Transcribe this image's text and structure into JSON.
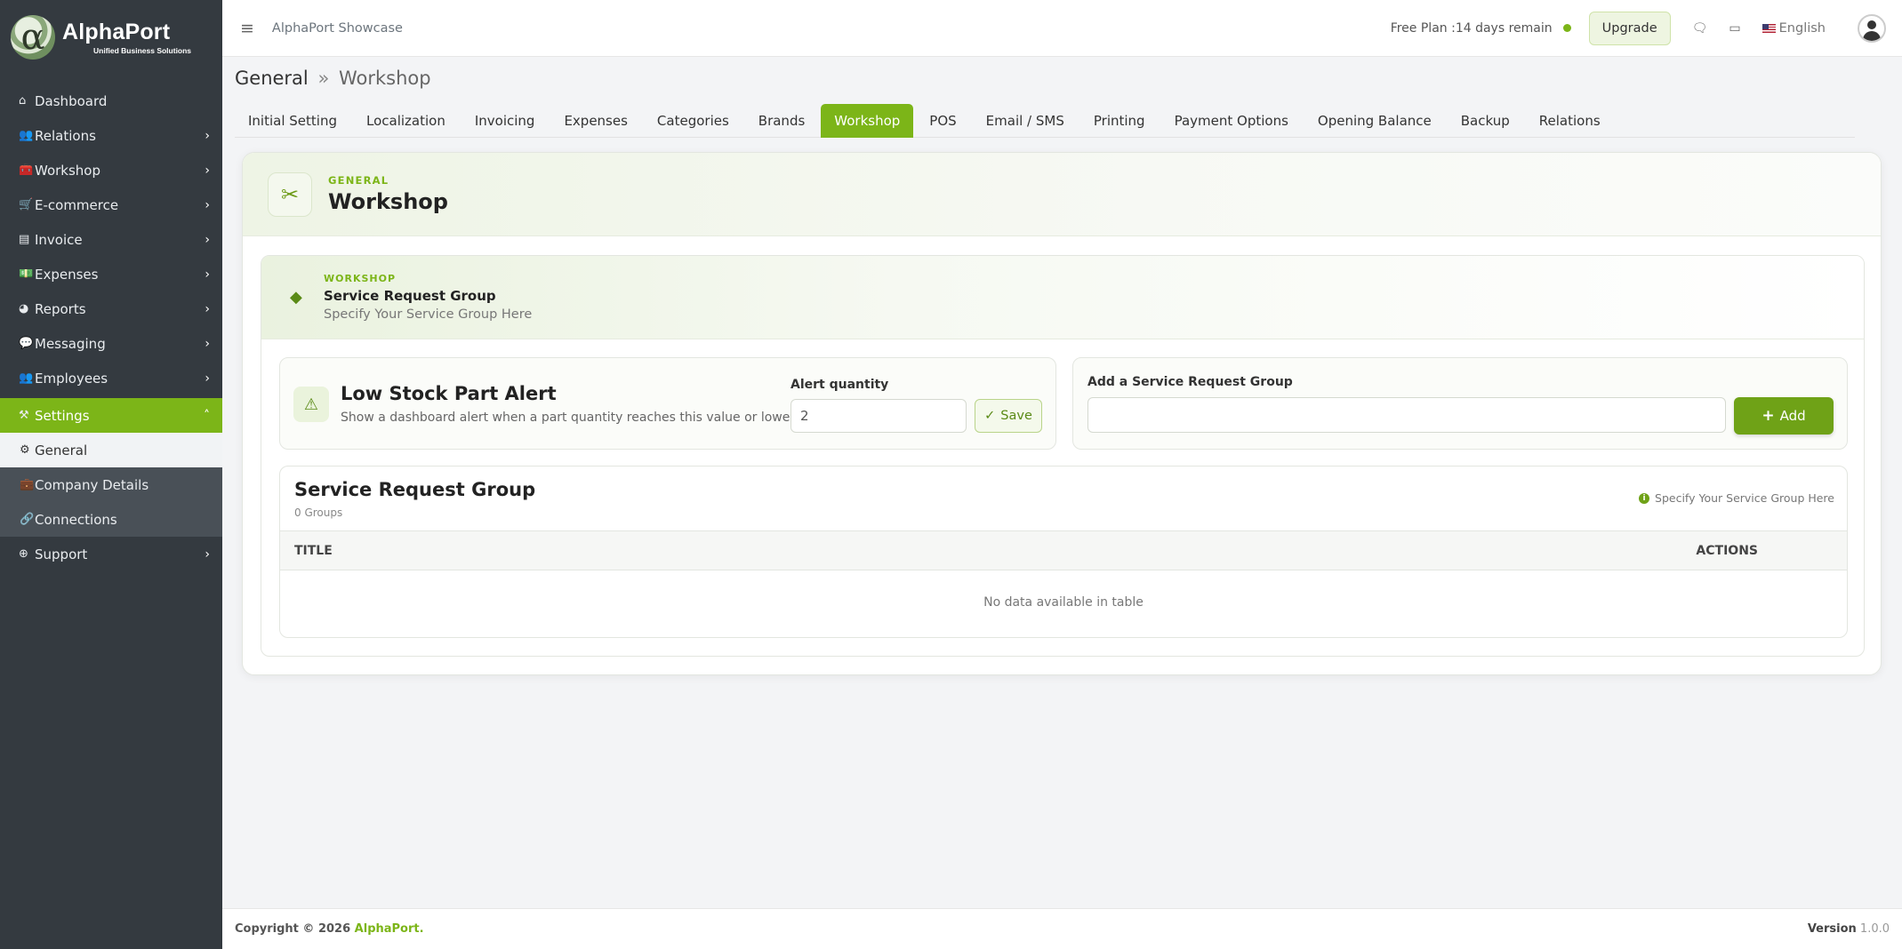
{
  "brand": {
    "name": "AlphaPort",
    "tagline": "Unified Business Solutions",
    "logo_glyph": "α",
    "accent": "#7cb518",
    "sidebar_bg": "#343a40"
  },
  "sidebar": {
    "items": [
      {
        "label": "Dashboard",
        "icon": "home-icon",
        "glyph": "⌂"
      },
      {
        "label": "Relations",
        "icon": "users-icon",
        "glyph": "👥"
      },
      {
        "label": "Workshop",
        "icon": "toolbox-icon",
        "glyph": "🧰"
      },
      {
        "label": "E-commerce",
        "icon": "cart-icon",
        "glyph": "🛒"
      },
      {
        "label": "Invoice",
        "icon": "file-icon",
        "glyph": "▤"
      },
      {
        "label": "Expenses",
        "icon": "money-icon",
        "glyph": "💵"
      },
      {
        "label": "Reports",
        "icon": "pie-chart-icon",
        "glyph": "◕"
      },
      {
        "label": "Messaging",
        "icon": "message-icon",
        "glyph": "💬"
      },
      {
        "label": "Employees",
        "icon": "user-group-icon",
        "glyph": "👥"
      },
      {
        "label": "Settings",
        "icon": "tools-icon",
        "glyph": "⚒"
      }
    ],
    "sub_items": [
      {
        "label": "General",
        "icon": "gear-icon",
        "glyph": "⚙"
      },
      {
        "label": "Company Details",
        "icon": "briefcase-icon",
        "glyph": "💼"
      },
      {
        "label": "Connections",
        "icon": "link-icon",
        "glyph": "🔗"
      }
    ],
    "support": {
      "label": "Support",
      "icon": "lifebuoy-icon",
      "glyph": "⊕"
    }
  },
  "topbar": {
    "app_name": "AlphaPort Showcase",
    "plan_text": "Free Plan :14 days remain",
    "upgrade_label": "Upgrade",
    "language": "English"
  },
  "breadcrumb": {
    "parent": "General",
    "separator": "»",
    "current": "Workshop"
  },
  "tabs": [
    "Initial Setting",
    "Localization",
    "Invoicing",
    "Expenses",
    "Categories",
    "Brands",
    "Workshop",
    "POS",
    "Email / SMS",
    "Printing",
    "Payment Options",
    "Opening Balance",
    "Backup",
    "Relations"
  ],
  "active_tab": "Workshop",
  "card": {
    "eyebrow": "GENERAL",
    "title": "Workshop"
  },
  "section": {
    "eyebrow": "WORKSHOP",
    "title": "Service Request Group",
    "subtitle": "Specify Your Service Group Here"
  },
  "low_stock": {
    "title": "Low Stock Part Alert",
    "description": "Show a dashboard alert when a part quantity reaches this value or lower.",
    "alert_label": "Alert quantity",
    "alert_value": "2",
    "save_label": "Save"
  },
  "add_group": {
    "label": "Add a Service Request Group",
    "value": "",
    "button_label": "Add"
  },
  "group_table": {
    "title": "Service Request Group",
    "count_text": "0 Groups",
    "hint": "Specify Your Service Group Here",
    "columns": [
      "TITLE",
      "ACTIONS"
    ],
    "empty_text": "No data available in table"
  },
  "footer": {
    "copyright": "Copyright © 2026",
    "brand": "AlphaPort.",
    "version_label": "Version",
    "version_number": "1.0.0"
  }
}
